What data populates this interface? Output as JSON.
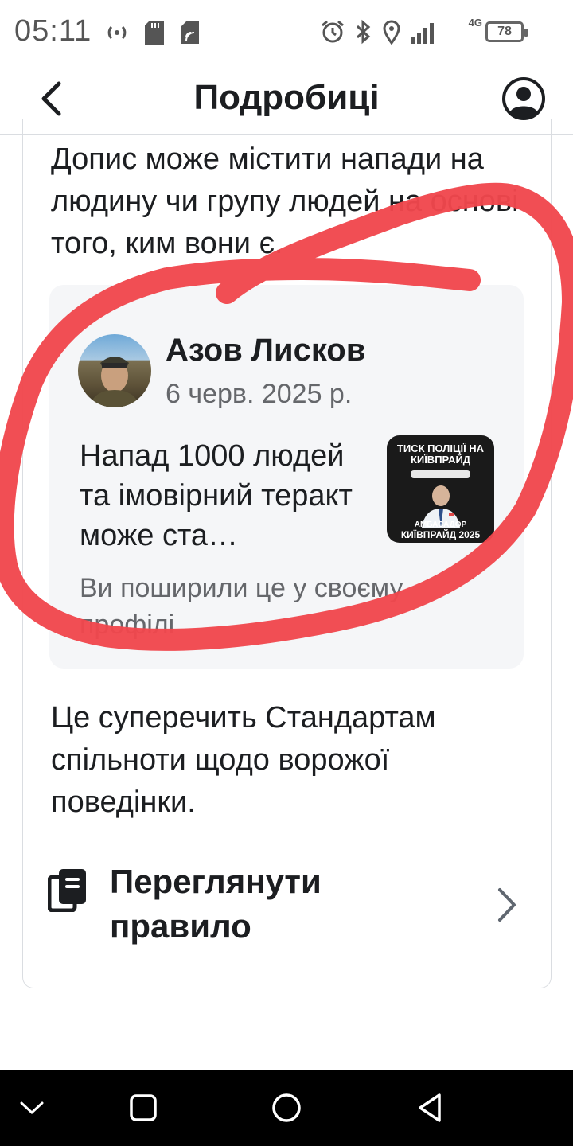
{
  "status_bar": {
    "time": "05:11",
    "network": "4G",
    "battery": "78"
  },
  "header": {
    "title": "Подробиці"
  },
  "intro": "Допис може містити напади на людину чи групу людей на основі того, ким вони є.",
  "post": {
    "author": "Азов Лисков",
    "date": "6 черв. 2025 р.",
    "excerpt": "Напад 1000 людей та імовірний теракт може ста…",
    "thumbnail": {
      "headline": "ТИСК ПОЛІЦІЇ НА КИЇВПРАЙД",
      "footer_small": "АМБАСАДОР",
      "footer_big": "КИЇВПРАЙД 2025"
    },
    "shared_note": "Ви поширили це у своєму профілі"
  },
  "violation": "Це суперечить Стандартам спільноти щодо ворожої поведінки.",
  "rule_link": {
    "label": "Переглянути правило"
  },
  "icons": {
    "back": "chevron-left-icon",
    "profile": "account-circle-icon",
    "rule": "book-icon",
    "chevron": "chevron-right-icon"
  },
  "colors": {
    "scribble": "#f0474d",
    "preview_bg": "#f5f6f8",
    "secondary_text": "#65676b"
  }
}
